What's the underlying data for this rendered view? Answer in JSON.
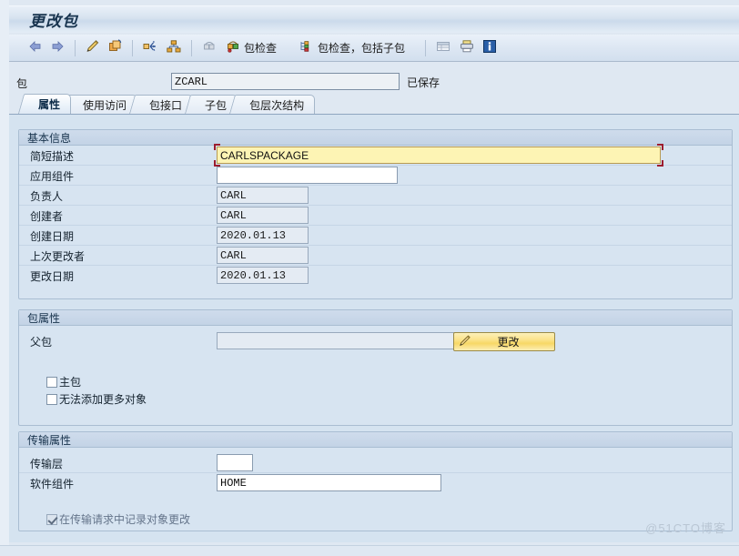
{
  "window": {
    "title": "更改包"
  },
  "toolbar": {
    "items": [
      {
        "name": "back-arrow",
        "icon": "arrow-left-icon",
        "label": ""
      },
      {
        "name": "forward-arrow",
        "icon": "arrow-right-icon",
        "label": ""
      },
      {
        "name": "display-change",
        "icon": "pencil-icon",
        "label": ""
      },
      {
        "name": "copy-package",
        "icon": "copy-icon",
        "label": ""
      },
      {
        "name": "where-used",
        "icon": "nodes-icon",
        "label": ""
      },
      {
        "name": "hierarchy",
        "icon": "tree-icon",
        "label": ""
      },
      {
        "name": "package-builder",
        "icon": "package-gray-icon",
        "label": ""
      },
      {
        "name": "package-check",
        "icon": "package-check-icon",
        "label": "包检查"
      },
      {
        "name": "package-check-subpackages",
        "icon": "package-tree-check-icon",
        "label": "包检查，包括子包"
      },
      {
        "name": "list-view",
        "icon": "table-icon",
        "label": ""
      },
      {
        "name": "print",
        "icon": "print-icon",
        "label": ""
      },
      {
        "name": "info",
        "icon": "info-icon",
        "label": ""
      }
    ]
  },
  "key_row": {
    "label": "包",
    "value": "ZCARL",
    "placeholder": "",
    "status": "已保存"
  },
  "tabs": [
    {
      "label": "属性",
      "active": true
    },
    {
      "label": "使用访问",
      "active": false
    },
    {
      "label": "包接口",
      "active": false
    },
    {
      "label": "子包",
      "active": false
    },
    {
      "label": "包层次结构",
      "active": false
    }
  ],
  "basic_info": {
    "title": "基本信息",
    "fields": [
      {
        "label": "简短描述",
        "value": "CARLSPACKAGE",
        "state": "focused"
      },
      {
        "label": "应用组件",
        "value": "",
        "state": "editable"
      },
      {
        "label": "负责人",
        "value": "CARL",
        "state": "readonly"
      },
      {
        "label": "创建者",
        "value": "CARL",
        "state": "readonly"
      },
      {
        "label": "创建日期",
        "value": "2020.01.13",
        "state": "readonly"
      },
      {
        "label": "上次更改者",
        "value": "CARL",
        "state": "readonly"
      },
      {
        "label": "更改日期",
        "value": "2020.01.13",
        "state": "readonly"
      }
    ]
  },
  "package_attributes": {
    "title": "包属性",
    "parent_package": {
      "label": "父包",
      "value": ""
    },
    "change_button": {
      "label": "更改",
      "icon": "pencil-icon"
    },
    "checkboxes": [
      {
        "label": "主包",
        "checked": false,
        "disabled": false
      },
      {
        "label": "无法添加更多对象",
        "checked": false,
        "disabled": false
      }
    ]
  },
  "transport_attributes": {
    "title": "传输属性",
    "fields": [
      {
        "label": "传输层",
        "value": ""
      },
      {
        "label": "软件组件",
        "value": "HOME"
      }
    ],
    "checkboxes": [
      {
        "label": "在传输请求中记录对象更改",
        "checked": true,
        "disabled": true
      }
    ]
  },
  "watermark": "@51CTO博客",
  "colors": {
    "window_bg": "#d5e3f0",
    "focus_field": "#fdf4b4",
    "focus_marker": "#9c1d2e",
    "button_gold": "#f7d866",
    "group_border": "#a9bdd2"
  }
}
